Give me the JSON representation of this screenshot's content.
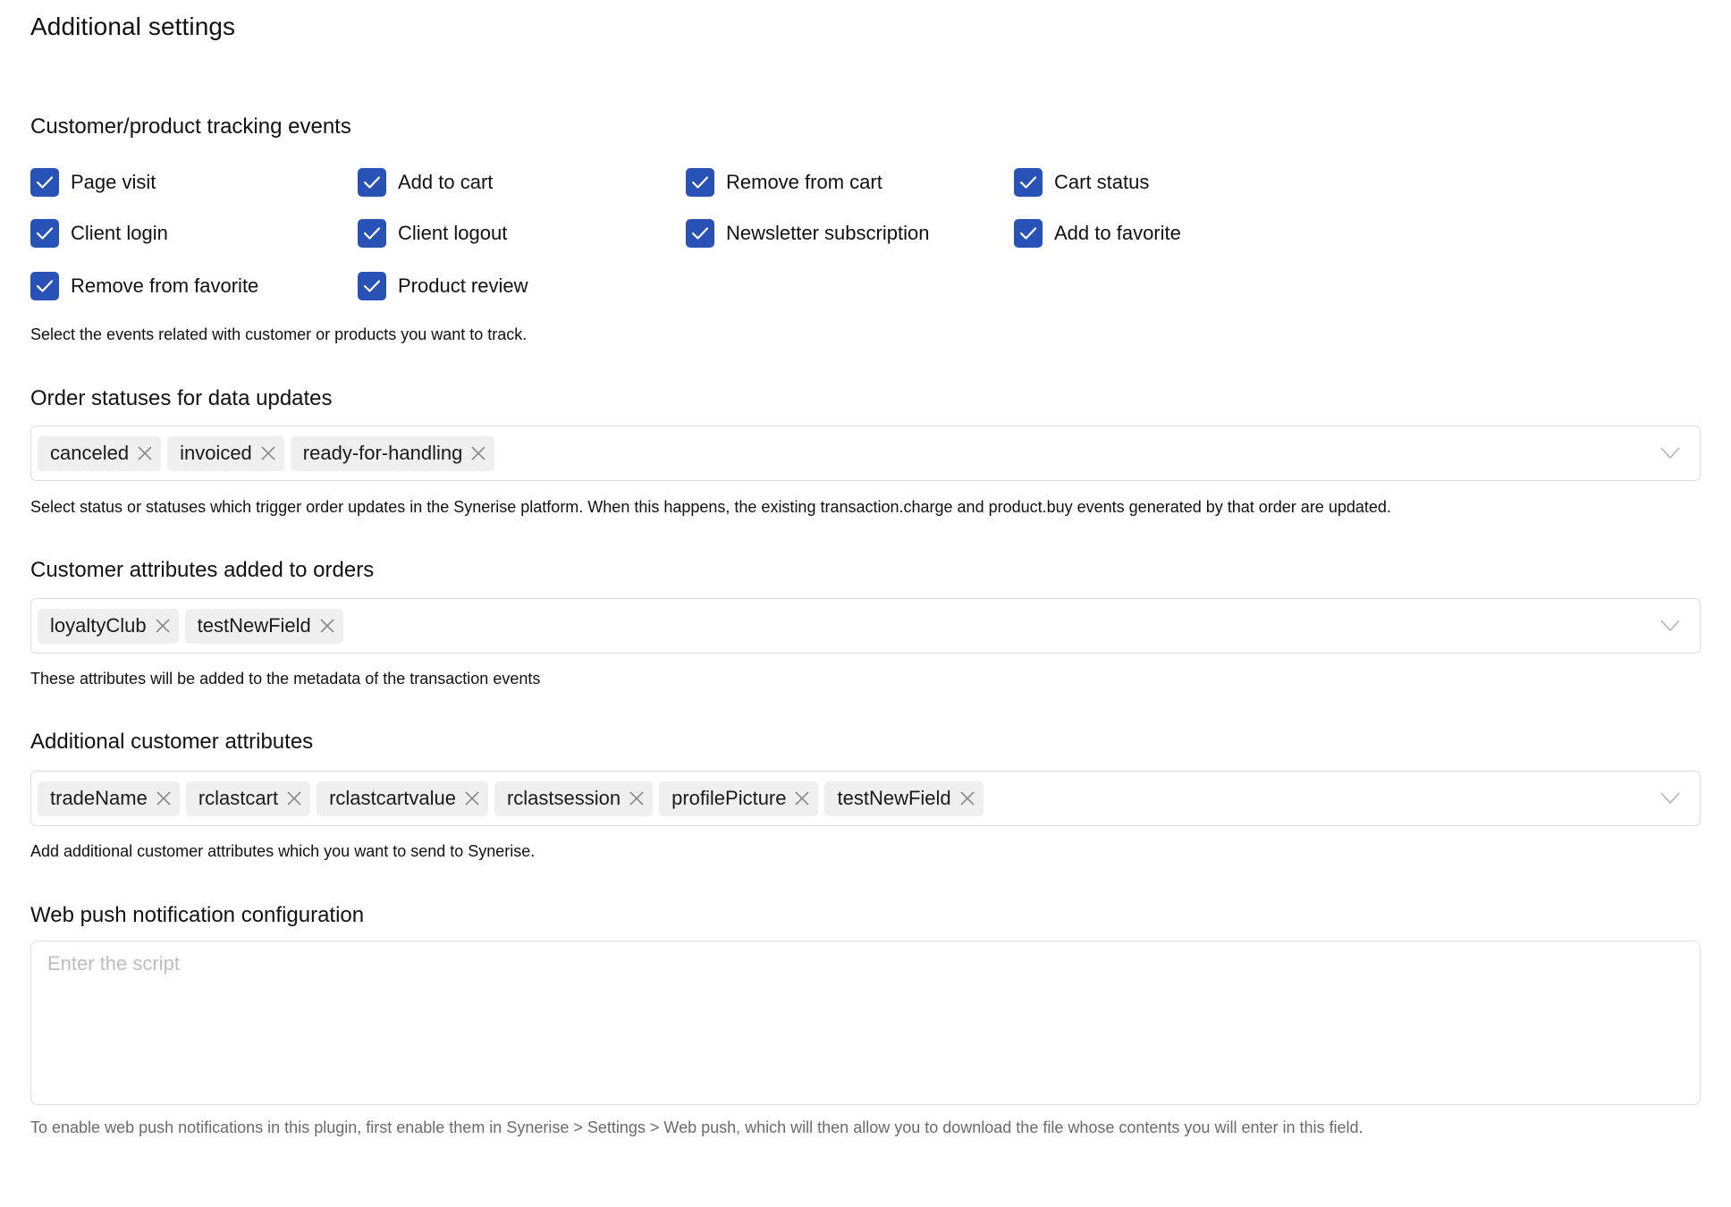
{
  "page": {
    "title": "Additional settings",
    "accent_color": "#2952b6"
  },
  "tracking": {
    "title": "Customer/product tracking events",
    "items": [
      {
        "label": "Page visit",
        "checked": true
      },
      {
        "label": "Add to cart",
        "checked": true
      },
      {
        "label": "Remove from cart",
        "checked": true
      },
      {
        "label": "Cart status",
        "checked": true
      },
      {
        "label": "Client login",
        "checked": true
      },
      {
        "label": "Client logout",
        "checked": true
      },
      {
        "label": "Newsletter subscription",
        "checked": true
      },
      {
        "label": "Add to favorite",
        "checked": true
      },
      {
        "label": "Remove from favorite",
        "checked": true
      },
      {
        "label": "Product review",
        "checked": true
      }
    ],
    "help": "Select the events related with customer or products you want to track."
  },
  "order_statuses": {
    "title": "Order statuses for data updates",
    "selected": [
      "canceled",
      "invoiced",
      "ready-for-handling"
    ],
    "help": "Select status or statuses which trigger order updates in the Synerise platform. When this happens, the existing transaction.charge and product.buy events generated by that order are updated."
  },
  "customer_attributes_orders": {
    "title": "Customer attributes added to orders",
    "selected": [
      "loyaltyClub",
      "testNewField"
    ],
    "help": "These attributes will be added to the metadata of the transaction events"
  },
  "additional_customer_attributes": {
    "title": "Additional customer attributes",
    "selected": [
      "tradeName",
      "rclastcart",
      "rclastcartvalue",
      "rclastsession",
      "profilePicture",
      "testNewField"
    ],
    "help": "Add additional customer attributes which you want to send to Synerise."
  },
  "web_push": {
    "title": "Web push notification configuration",
    "value": "",
    "placeholder": "Enter the script",
    "help": "To enable web push notifications in this plugin, first enable them in Synerise > Settings > Web push, which will then allow you to download the file whose contents you will enter in this field."
  }
}
